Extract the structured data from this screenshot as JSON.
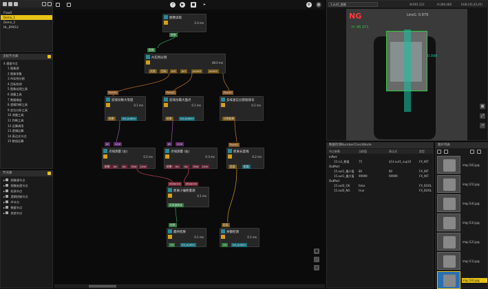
{
  "flow_list": {
    "items": [
      "Flow0",
      "Demo_1",
      "Demo_2",
      "HL_EM412"
    ]
  },
  "toolbox": {
    "title": "流程节点库",
    "root": "4 通道节点",
    "items": [
      "1 图像源",
      "2 图像采集",
      "3 AI实例分割",
      "4 目标检测",
      "5 图像处理工具",
      "6 测量工具",
      "7 数据输出",
      "8 逻辑判断工具",
      "9 定位分析工具",
      "10 测量工具",
      "11 判断工具",
      "12 运算调用",
      "13 逻辑运算",
      "14 表达式节点",
      "15 数组运算"
    ]
  },
  "library": {
    "title": "节点库",
    "items": [
      "图像源节点",
      "图像处理节点",
      "检测节点",
      "逻辑控制节点",
      "AI节点",
      "数据节点",
      "其他节点"
    ]
  },
  "canvas": {
    "nodes": [
      {
        "name": "图像读取",
        "time": "2.0 ms"
      },
      {
        "name": "AI实例分割",
        "time": "48.0 ms"
      },
      {
        "name": "前排份数大等提",
        "time": "0.1 ms"
      },
      {
        "name": "前排份最大面点",
        "time": "0.1 ms"
      },
      {
        "name": "多排查信分割值排号",
        "time": "0.1 ms"
      },
      {
        "name": "点线测量 (左)",
        "time": "0.2 ms"
      },
      {
        "name": "点线测量 (右)",
        "time": "0.3 ms"
      },
      {
        "name": "距离长度线",
        "time": "0.2 ms"
      },
      {
        "name": "距离小偏移量测",
        "time": "0.1 ms"
      },
      {
        "name": "最终结果",
        "time": "0.1 ms"
      },
      {
        "name": "余额检测",
        "time": "0.1 ms"
      }
    ],
    "port_labels": {
      "read_out": "图像",
      "ai_in": "图像",
      "ai_outs": [
        "天规",
        "目标",
        "pt0",
        "pt1",
        "point0",
        "point1"
      ],
      "p3_in": "Point1",
      "p4_in": "Point1",
      "p5_in": "Point2",
      "p3_outs": [
        "结果",
        "Int_outlier"
      ],
      "p4_outs": [
        "结果",
        "Int_outlier"
      ],
      "p5_outs": [
        "分割结果"
      ],
      "m1_in": [
        "pt",
        "Line"
      ],
      "m2_in": [
        "pt",
        "Line"
      ],
      "m1_outs": [
        "结果",
        "dx",
        "dy",
        "Dist",
        "Line"
      ],
      "m2_outs": [
        "结果",
        "dx",
        "dy",
        "Dist",
        "Line"
      ],
      "len_in": "Point2",
      "len_outs": [
        "距离",
        "距离"
      ],
      "off_in": [
        "distance",
        "distance"
      ],
      "off_out": "距离偏移量",
      "final_in": "结果",
      "final_outs": [
        "OK",
        "Int_outlier"
      ],
      "ch_in": "距离",
      "ch_outs": [
        "OK",
        "Int_outlier"
      ]
    }
  },
  "image_view": {
    "dropdown": "1.out1_图像",
    "readouts": [
      "W:691.522",
      "H:286.468",
      "RGB:(45,45,45)"
    ],
    "label_ng": "NG",
    "label_code": "H: 95 971",
    "label_line1": "Line1: 0.979",
    "label_value": "0.998"
  },
  "params": {
    "title": "数据检测NumberCheckNode",
    "columns": [
      "节点参数",
      "当前值",
      "表达式",
      "类型"
    ],
    "groups": [
      {
        "name": "InPort",
        "rows": [
          {
            "k": "15.in1_数值",
            "v": "75",
            "e": "$14.out1_sup10",
            "t": "FX_INT"
          }
        ]
      },
      {
        "name": "OutPort",
        "rows": [
          {
            "k": "15.out1_最小值",
            "v": "80",
            "e": "80",
            "t": "FX_INT"
          },
          {
            "k": "15.out1_最大值",
            "v": "99999",
            "e": "99999",
            "t": "FX_INT"
          }
        ]
      },
      {
        "name": "OutPort",
        "rows": [
          {
            "k": "15.out0_OK",
            "v": "false",
            "e": "",
            "t": "FX_BOOL"
          },
          {
            "k": "15.out0_NG",
            "v": "true",
            "e": "",
            "t": "FX_BOOL"
          }
        ]
      }
    ]
  },
  "gallery": {
    "title": "图片列表",
    "items": [
      "img (16).jpg",
      "img (15).jpg",
      "img (14).jpg",
      "img (13).jpg",
      "img (12).jpg",
      "img (11).jpg",
      "img (10).jpg"
    ],
    "selected": "img (10).jpg"
  },
  "colors": {
    "accent": "#e8c318",
    "teal": "#1d8f9c",
    "port_red": "#7a2a3a",
    "port_orange": "#8a5a2a"
  }
}
